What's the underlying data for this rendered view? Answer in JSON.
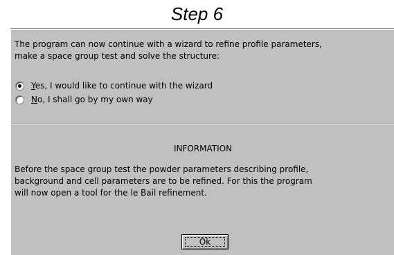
{
  "page_title": "Step 6",
  "prompt_lines": [
    "The program can now continue with a wizard to refine profile parameters,",
    "make a space group test and solve the structure:"
  ],
  "options": [
    {
      "mnemonic": "Y",
      "rest": "es, I would like to continue with the wizard",
      "selected": true
    },
    {
      "mnemonic": "N",
      "rest": "o, I shall go by my own way",
      "selected": false
    }
  ],
  "info_heading": "INFORMATION",
  "info_lines": [
    "Before the space group test the powder parameters describing profile,",
    "background and cell parameters are to be refined. For this the program",
    "will now open a tool for the le Bail refinement."
  ],
  "ok_label": "Ok",
  "colors": {
    "dialog_face": "#c0c0c0",
    "shadow": "#808080",
    "highlight": "#ffffff"
  }
}
